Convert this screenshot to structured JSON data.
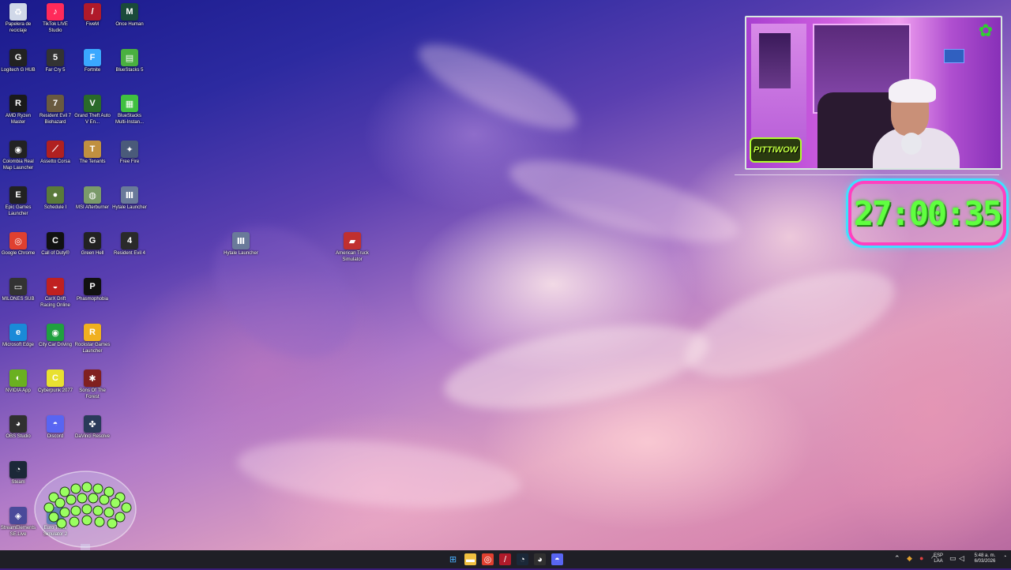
{
  "desktop": {
    "icons": [
      {
        "label": "Papelera de reciclaje",
        "icon": "recycle-bin-icon",
        "color": "#d0d8e8",
        "glyph": "♻"
      },
      {
        "label": "TikTok LIVE Studio",
        "icon": "tiktok-icon",
        "color": "#ff2a5a",
        "glyph": "♪"
      },
      {
        "label": "FiveM",
        "icon": "fivem-icon",
        "color": "#b01a2a",
        "glyph": "/"
      },
      {
        "label": "Once Human",
        "icon": "once-human-icon",
        "color": "#1a4a3a",
        "glyph": "M"
      },
      {
        "label": "Logitech G HUB",
        "icon": "logitech-icon",
        "color": "#222222",
        "glyph": "G"
      },
      {
        "label": "Far Cry 5",
        "icon": "far-cry-icon",
        "color": "#333333",
        "glyph": "5"
      },
      {
        "label": "Fortnite",
        "icon": "fortnite-icon",
        "color": "#3aa8ff",
        "glyph": "F"
      },
      {
        "label": "BlueStacks 5",
        "icon": "bluestacks-icon",
        "color": "#4ab040",
        "glyph": "▤"
      },
      {
        "label": "AMD Ryzen Master",
        "icon": "amd-ryzen-icon",
        "color": "#1a1a1a",
        "glyph": "R"
      },
      {
        "label": "Resident Evil 7 Biohazard",
        "icon": "resident-evil-7-icon",
        "color": "#6a5a40",
        "glyph": "7"
      },
      {
        "label": "Grand Theft Auto V En...",
        "icon": "gta-v-icon",
        "color": "#2a6a2a",
        "glyph": "V"
      },
      {
        "label": "BlueStacks Multi-Instan...",
        "icon": "bluestacks-multi-icon",
        "color": "#40c040",
        "glyph": "▦"
      },
      {
        "label": "Colombia Real Map Launcher",
        "icon": "colombia-map-icon",
        "color": "#222222",
        "glyph": "◉"
      },
      {
        "label": "Assetto Corsa",
        "icon": "assetto-corsa-icon",
        "color": "#b02020",
        "glyph": "⟋"
      },
      {
        "label": "The Tenants",
        "icon": "the-tenants-icon",
        "color": "#c09040",
        "glyph": "T"
      },
      {
        "label": "Free Fire",
        "icon": "free-fire-icon",
        "color": "#4a5a7a",
        "glyph": "✦"
      },
      {
        "label": "Epic Games Launcher",
        "icon": "epic-games-icon",
        "color": "#222222",
        "glyph": "E"
      },
      {
        "label": "Schedule I",
        "icon": "schedule-one-icon",
        "color": "#5a7a3a",
        "glyph": "●"
      },
      {
        "label": "MSI Afterburner",
        "icon": "msi-afterburner-icon",
        "color": "#7a9a6a",
        "glyph": "◍"
      },
      {
        "label": "Hytale Launcher",
        "icon": "hytale-icon",
        "color": "#6a7a9a",
        "glyph": "Ⅲ"
      },
      {
        "label": "Google Chrome",
        "icon": "chrome-icon",
        "color": "#e04030",
        "glyph": "◎"
      },
      {
        "label": "Call of Duty®",
        "icon": "call-of-duty-icon",
        "color": "#111111",
        "glyph": "C"
      },
      {
        "label": "Green Hell",
        "icon": "green-hell-icon",
        "color": "#222222",
        "glyph": "G"
      },
      {
        "label": "Resident Evil 4",
        "icon": "resident-evil-4-icon",
        "color": "#2a2a2a",
        "glyph": "4"
      },
      {
        "label": "MILONES SUB",
        "icon": "milones-sub-icon",
        "color": "#333333",
        "glyph": "▭"
      },
      {
        "label": "CarX Drift Racing Online",
        "icon": "carx-drift-icon",
        "color": "#c02020",
        "glyph": "◒"
      },
      {
        "label": "Phasmophobia",
        "icon": "phasmophobia-icon",
        "color": "#111111",
        "glyph": "P"
      },
      {
        "label": "Microsoft Edge",
        "icon": "edge-icon",
        "color": "#1a8ad8",
        "glyph": "e"
      },
      {
        "label": "City Car Driving",
        "icon": "city-car-driving-icon",
        "color": "#20a040",
        "glyph": "◉"
      },
      {
        "label": "Rockstar Games Launcher",
        "icon": "rockstar-icon",
        "color": "#f0b020",
        "glyph": "R"
      },
      {
        "label": "NVIDIA App",
        "icon": "nvidia-icon",
        "color": "#6ab020",
        "glyph": "◐"
      },
      {
        "label": "Cyberpunk 2077",
        "icon": "cyberpunk-icon",
        "color": "#e8e030",
        "glyph": "C"
      },
      {
        "label": "Sons Of The Forest",
        "icon": "sons-forest-icon",
        "color": "#802020",
        "glyph": "✱"
      },
      {
        "label": "OBS Studio",
        "icon": "obs-icon",
        "color": "#303030",
        "glyph": "◕"
      },
      {
        "label": "Discord",
        "icon": "discord-icon",
        "color": "#5865f2",
        "glyph": "◓"
      },
      {
        "label": "DaVinci Resolve",
        "icon": "davinci-icon",
        "color": "#2a3a5a",
        "glyph": "✤"
      },
      {
        "label": "Steam",
        "icon": "steam-icon",
        "color": "#1b2838",
        "glyph": "◔"
      },
      {
        "label": "StreamElements SE.Live",
        "icon": "streamelements-icon",
        "color": "#4a4a9a",
        "glyph": "◈"
      },
      {
        "label": "Euro Truck Simulator 2",
        "icon": "euro-truck-icon",
        "color": "#3a5aa0",
        "glyph": "▰"
      }
    ],
    "loose_icons": [
      {
        "label": "Hytale Launcher",
        "icon": "hytale-icon",
        "color": "#6a7a9a",
        "glyph": "Ⅲ"
      },
      {
        "label": "American Truck Simulator",
        "icon": "american-truck-icon",
        "color": "#c03030",
        "glyph": "▰"
      }
    ]
  },
  "overlay": {
    "streamer_name": "PITTIWOW",
    "timer": "27:00:35",
    "accent_pink": "#ff40c0",
    "accent_cyan": "#40e0ff",
    "timer_green": "#60ff40"
  },
  "taskbar": {
    "pinned": [
      {
        "name": "start-button",
        "glyph": "⊞",
        "color": "#4ab0ff"
      },
      {
        "name": "file-explorer-button",
        "glyph": "▬",
        "color": "#f0c040"
      },
      {
        "name": "chrome-button",
        "glyph": "◎",
        "color": "#e04030"
      },
      {
        "name": "fivem-button",
        "glyph": "/",
        "color": "#b01a2a"
      },
      {
        "name": "steam-button",
        "glyph": "◔",
        "color": "#1b2838"
      },
      {
        "name": "obs-button",
        "glyph": "◕",
        "color": "#303030"
      },
      {
        "name": "discord-button",
        "glyph": "◓",
        "color": "#5865f2"
      }
    ],
    "tray": {
      "language_line1": "ESP",
      "language_line2": "LAA",
      "time": "5:48 a. m.",
      "date": "6/03/2026"
    }
  }
}
